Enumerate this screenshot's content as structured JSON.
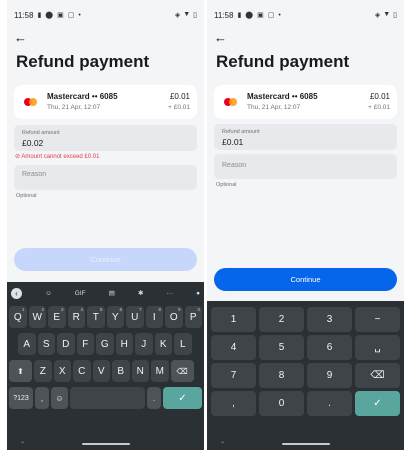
{
  "status": {
    "time": "11:58"
  },
  "screen": {
    "title": "Refund payment",
    "card": {
      "name": "Mastercard •• 6085",
      "date": "Thu, 21 Apr, 12:07",
      "amount": "£0.01",
      "sub_amount": "+ £0.01"
    },
    "refund_amount_label": "Refund amount",
    "reason_placeholder": "Reason",
    "optional": "Optional",
    "continue_label": "Continue"
  },
  "left": {
    "refund_value": "£0.02",
    "error": "⊘ Amount cannot exceed £0.01",
    "continue_enabled": false
  },
  "right": {
    "refund_value": "£0.01",
    "continue_enabled": true
  },
  "keyboard": {
    "toolbar": [
      "GIF",
      "···"
    ],
    "row1": [
      {
        "k": "Q",
        "n": "1"
      },
      {
        "k": "W",
        "n": "2"
      },
      {
        "k": "E",
        "n": "3"
      },
      {
        "k": "R",
        "n": "4"
      },
      {
        "k": "T",
        "n": "5"
      },
      {
        "k": "Y",
        "n": "6"
      },
      {
        "k": "U",
        "n": "7"
      },
      {
        "k": "I",
        "n": "8"
      },
      {
        "k": "O",
        "n": "9"
      },
      {
        "k": "P",
        "n": "0"
      }
    ],
    "row2": [
      "A",
      "S",
      "D",
      "F",
      "G",
      "H",
      "J",
      "K",
      "L"
    ],
    "row3": [
      "Z",
      "X",
      "C",
      "V",
      "B",
      "N",
      "M"
    ],
    "symbols_label": "?123",
    "comma": ",",
    "period": "."
  },
  "numpad": {
    "rows": [
      [
        "1",
        "2",
        "3",
        "−"
      ],
      [
        "4",
        "5",
        "6",
        "␣"
      ],
      [
        "7",
        "8",
        "9",
        "⌫"
      ],
      [
        ",",
        "0",
        ".",
        "✓"
      ]
    ]
  },
  "colors": {
    "accent": "#0666eb",
    "error": "#e23b4a",
    "keyboard_bg": "#2b3034"
  }
}
